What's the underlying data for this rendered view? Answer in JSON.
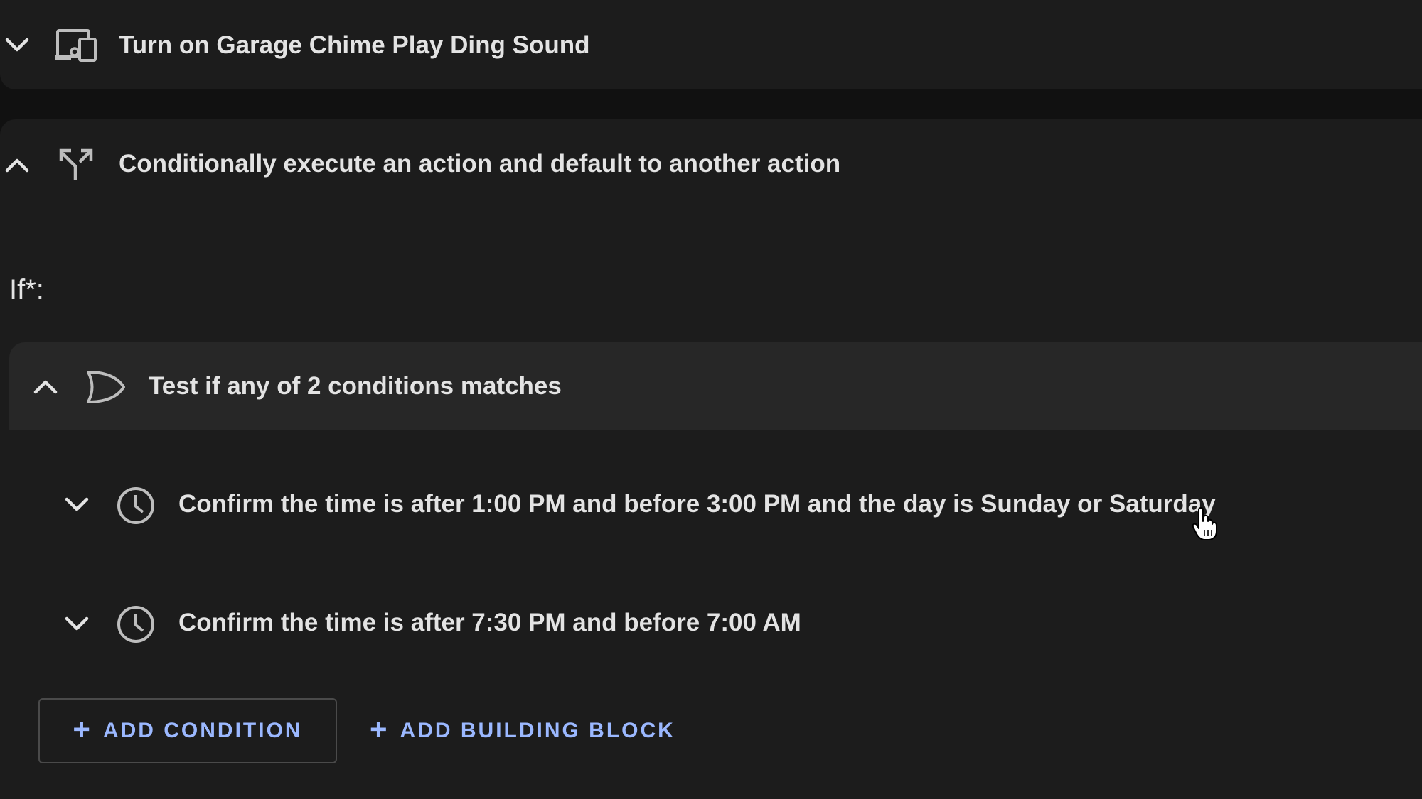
{
  "action_device": {
    "title": "Turn on Garage Chime Play Ding Sound",
    "icon": "remote-devices-icon"
  },
  "action_choose": {
    "title": "Conditionally execute an action and default to another action",
    "icon": "call-split-icon"
  },
  "if_section": {
    "label": "If*:",
    "or_block": {
      "title": "Test if any of 2 conditions matches",
      "icon": "gate-or-icon"
    },
    "conditions": [
      {
        "text": "Confirm the time is after 1:00 PM and before 3:00 PM and the day is Sunday or Saturday",
        "icon": "clock-icon"
      },
      {
        "text": "Confirm the time is after 7:30 PM and before 7:00 AM",
        "icon": "clock-icon"
      }
    ],
    "buttons": {
      "add_condition": "ADD CONDITION",
      "add_building_block": "ADD BUILDING BLOCK"
    }
  },
  "colors": {
    "background": "#111111",
    "card": "#1c1c1c",
    "card_header": "#272727",
    "accent": "#9bb8ff",
    "text": "#e3e3e3"
  }
}
